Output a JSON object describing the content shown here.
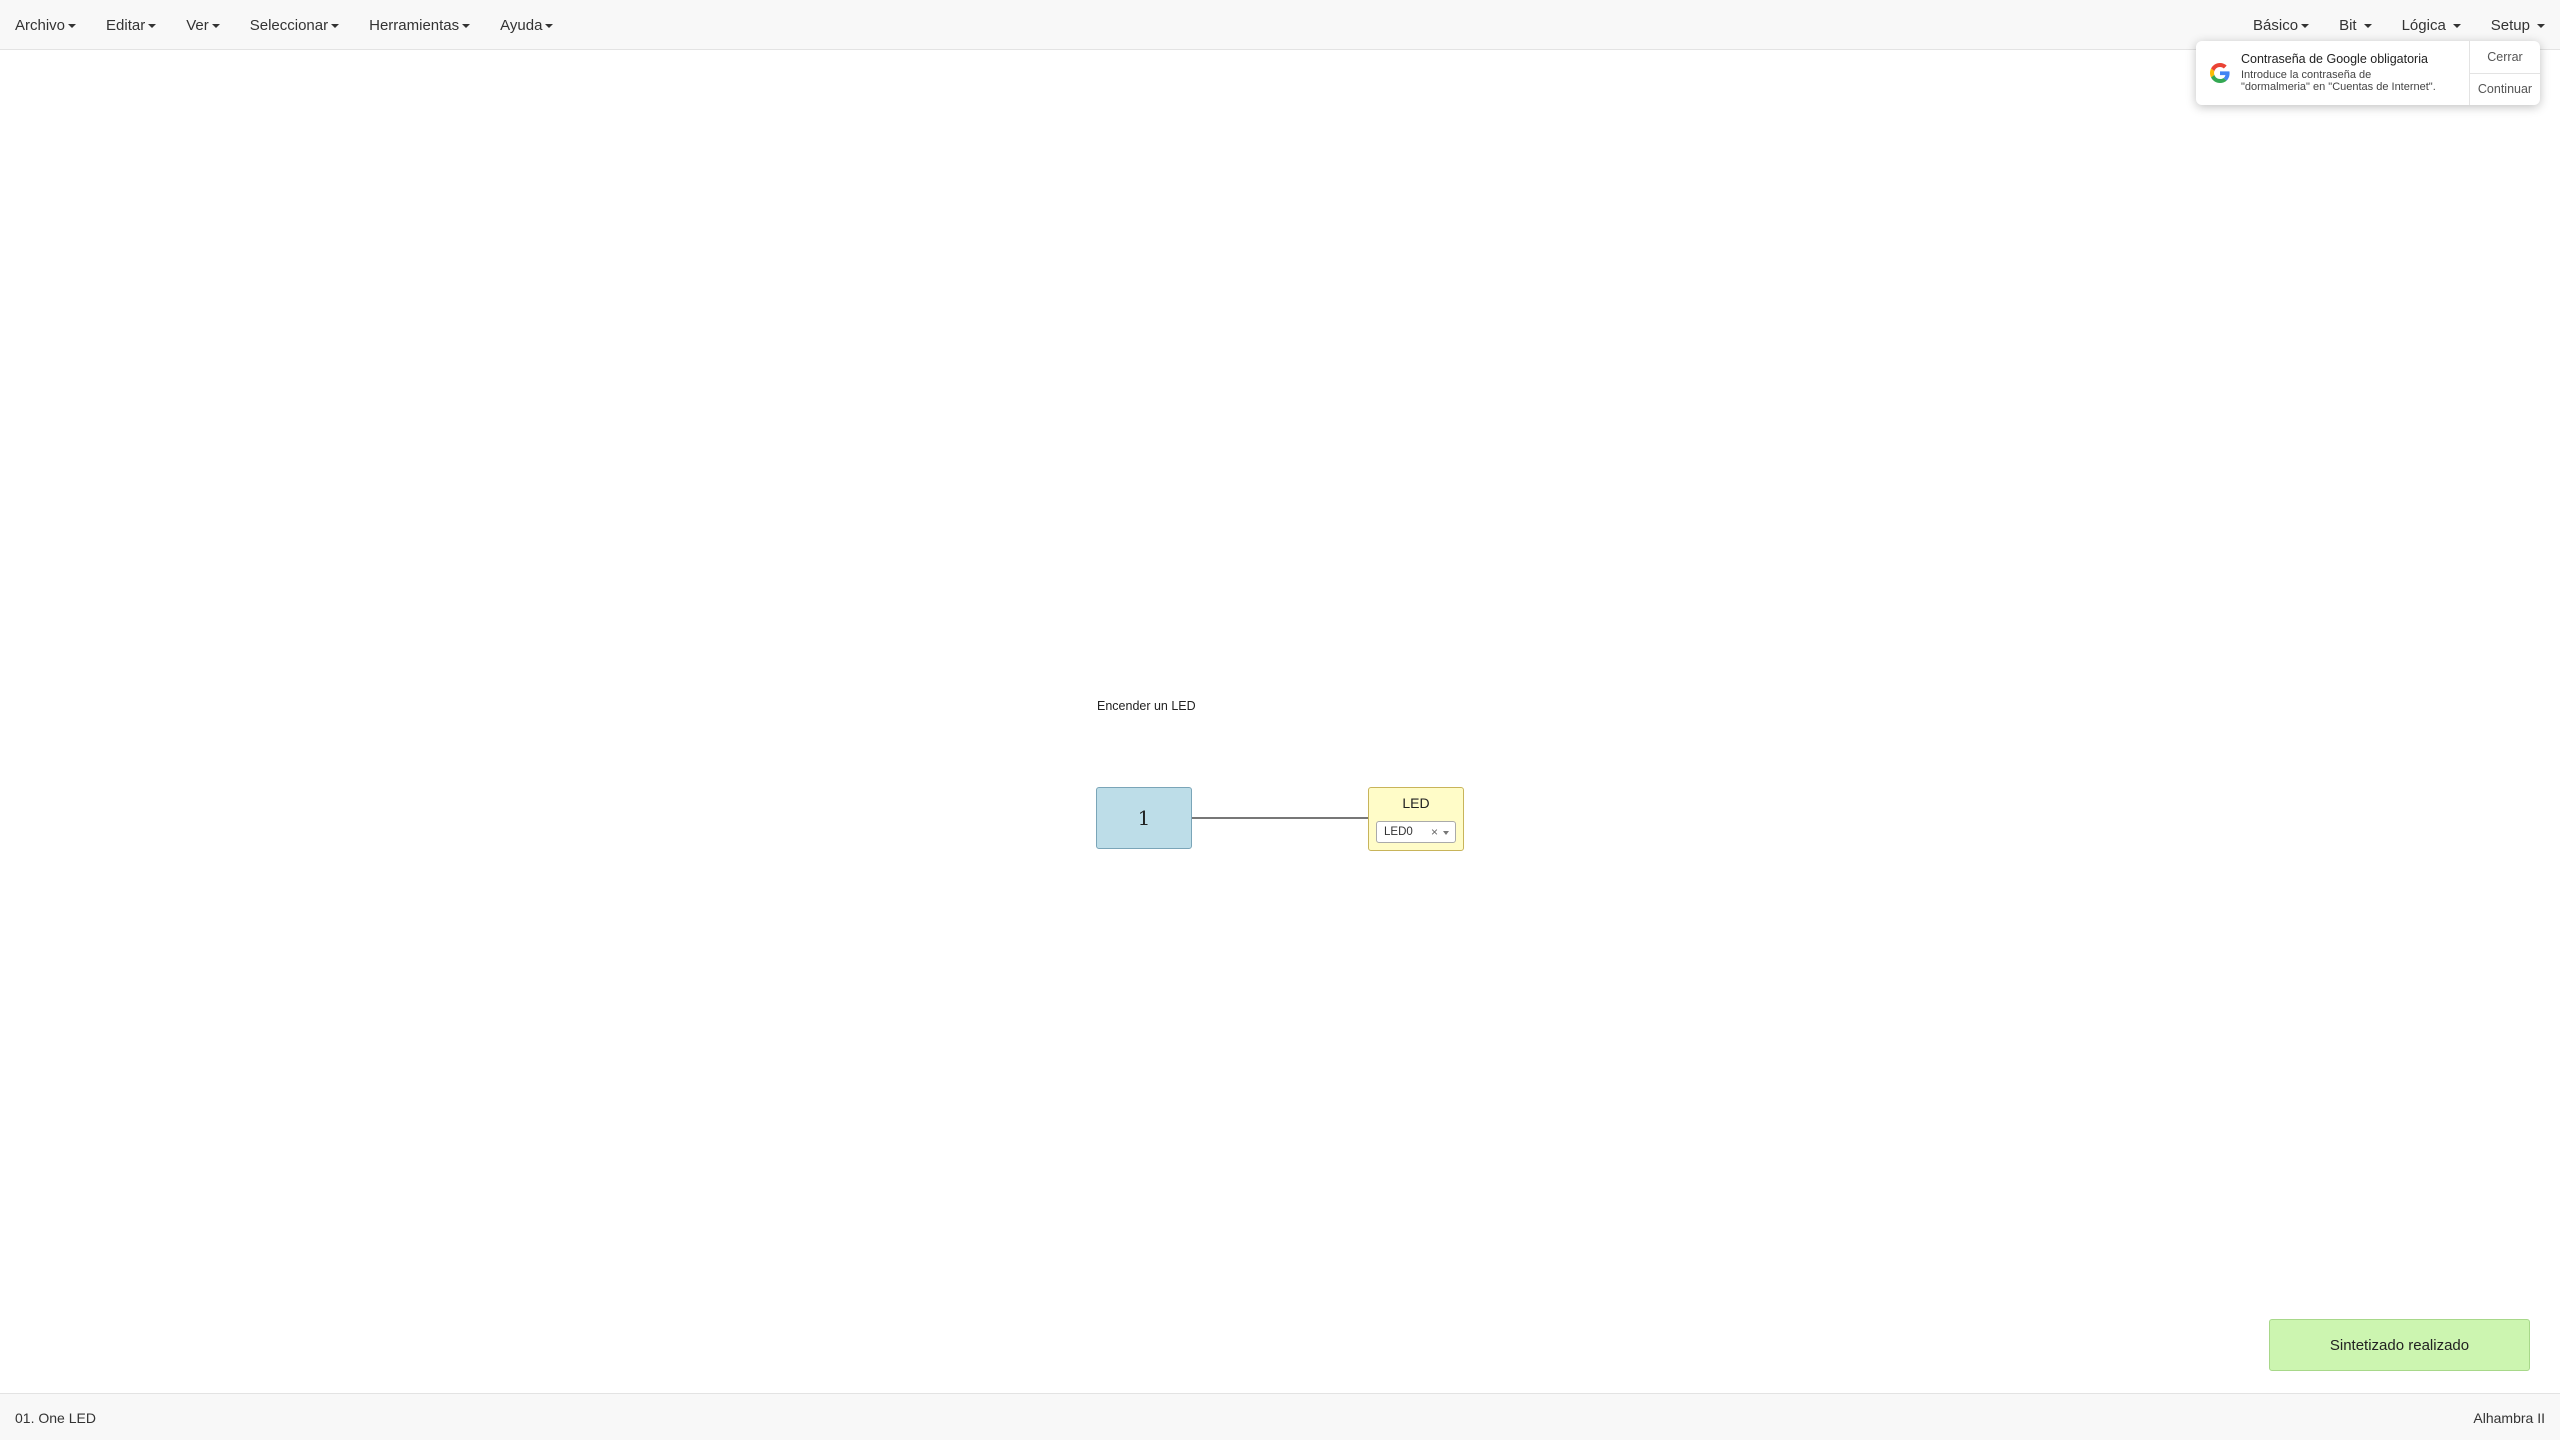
{
  "menubar": {
    "left": [
      {
        "label": "Archivo"
      },
      {
        "label": "Editar"
      },
      {
        "label": "Ver"
      },
      {
        "label": "Seleccionar"
      },
      {
        "label": "Herramientas"
      },
      {
        "label": "Ayuda"
      }
    ],
    "right": [
      {
        "label": "Básico"
      },
      {
        "label": "Bit"
      },
      {
        "label": "Lógica"
      },
      {
        "label": "Setup"
      }
    ]
  },
  "password_prompt": {
    "icon": "google-icon",
    "title": "Contraseña de Google obligatoria",
    "message_line1": "Introduce la contraseña de",
    "message_line2": "\"dormalmeria\" en \"Cuentas de Internet\".",
    "close_label": "Cerrar",
    "continue_label": "Continuar"
  },
  "canvas": {
    "info_text": "Encender un LED",
    "constant_block": {
      "value": "1"
    },
    "led_block": {
      "title": "LED",
      "pin": "LED0",
      "clear_symbol": "×"
    }
  },
  "notification": {
    "text": "Sintetizado realizado",
    "color": "#ccf5b0"
  },
  "footer": {
    "project_name": "01. One LED",
    "board": "Alhambra II"
  }
}
